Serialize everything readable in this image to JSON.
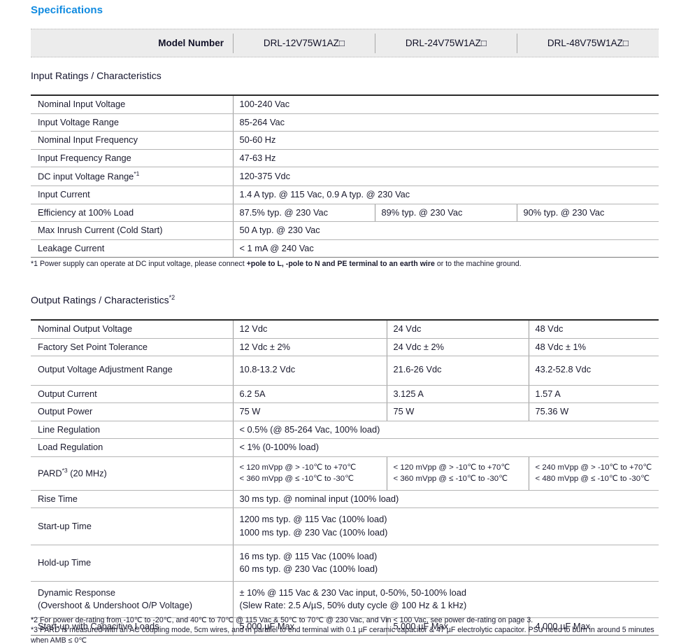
{
  "title": "Specifications",
  "accent_color": "#0f8ae0",
  "header_bg": "#ececec",
  "model_header": {
    "label": "Model Number",
    "models": [
      "DRL-12V75W1AZ□",
      "DRL-24V75W1AZ□",
      "DRL-48V75W1AZ□"
    ]
  },
  "input_section": {
    "heading": "Input Ratings / Characteristics",
    "rows": [
      {
        "label": "Nominal Input Voltage",
        "span": 3,
        "values": [
          "100-240 Vac"
        ]
      },
      {
        "label": "Input Voltage Range",
        "span": 3,
        "values": [
          "85-264 Vac"
        ]
      },
      {
        "label": "Nominal Input Frequency",
        "span": 3,
        "values": [
          "50-60 Hz"
        ]
      },
      {
        "label": "Input Frequency Range",
        "span": 3,
        "values": [
          "47-63 Hz"
        ]
      },
      {
        "label": "DC input Voltage Range",
        "sup": "*1",
        "span": 3,
        "values": [
          "120-375 Vdc"
        ]
      },
      {
        "label": "Input Current",
        "span": 3,
        "values": [
          "1.4 A typ. @ 115 Vac, 0.9 A typ. @ 230 Vac"
        ]
      },
      {
        "label": "Efficiency at 100% Load",
        "span": 1,
        "values": [
          "87.5% typ. @ 230 Vac",
          "89% typ. @ 230 Vac",
          "90% typ. @ 230 Vac"
        ]
      },
      {
        "label": "Max Inrush Current (Cold Start)",
        "span": 3,
        "values": [
          "50 A typ. @ 230 Vac"
        ]
      },
      {
        "label": "Leakage Current",
        "span": 3,
        "values": [
          "< 1 mA @ 240 Vac"
        ]
      }
    ],
    "footnote_prefix": "*1 Power supply can operate at DC input voltage, please connect ",
    "footnote_bold": "+pole to L, -pole to N and PE terminal to an earth wire",
    "footnote_suffix": " or to the machine ground."
  },
  "output_section": {
    "heading": "Output Ratings / Characteristics",
    "heading_sup": "*2",
    "rows": [
      {
        "label": "Nominal Output Voltage",
        "span": 1,
        "values": [
          "12 Vdc",
          "24 Vdc",
          "48 Vdc"
        ]
      },
      {
        "label": "Factory Set Point Tolerance",
        "span": 1,
        "values": [
          "12 Vdc ± 2%",
          "24 Vdc ± 2%",
          "48 Vdc ± 1%"
        ]
      },
      {
        "label": "Output Voltage Adjustment Range",
        "span": 1,
        "values": [
          "10.8-13.2 Vdc",
          "21.6-26 Vdc",
          "43.2-52.8 Vdc"
        ]
      },
      {
        "label": "Output Current",
        "span": 1,
        "values": [
          "6.2 5A",
          "3.125 A",
          "1.57 A"
        ]
      },
      {
        "label": "Output Power",
        "span": 1,
        "values": [
          "75 W",
          "75 W",
          "75.36 W"
        ]
      },
      {
        "label": "Line Regulation",
        "span": 3,
        "values": [
          "< 0.5% (@ 85-264 Vac, 100% load)"
        ]
      },
      {
        "label": "Load Regulation",
        "span": 3,
        "values": [
          "< 1% (0-100% load)"
        ]
      },
      {
        "label": "PARD",
        "sup": "*3",
        "label_tail": " (20 MHz)",
        "span": 1,
        "variant": "pard",
        "multi": [
          [
            "< 120 mVpp @ > -10℃ to +70℃",
            "< 360 mVpp @ ≤ -10℃ to -30℃"
          ],
          [
            "< 120 mVpp @ > -10℃ to +70℃",
            "< 360 mVpp @ ≤ -10℃ to -30℃"
          ],
          [
            "< 240 mVpp @ > -10℃ to +70℃",
            "< 480 mVpp @ ≤ -10℃ to -30℃"
          ]
        ]
      },
      {
        "label": "Rise Time",
        "span": 3,
        "values": [
          "30 ms typ. @ nominal input (100% load)"
        ]
      },
      {
        "label": "Start-up Time",
        "span": 3,
        "lines": [
          "1200 ms typ. @ 115 Vac (100% load)",
          "1000 ms typ. @ 230 Vac (100% load)"
        ]
      },
      {
        "label": "Hold-up Time",
        "span": 3,
        "lines": [
          "16 ms typ. @ 115 Vac (100% load)",
          "60 ms typ. @ 230 Vac (100% load)"
        ]
      },
      {
        "label_lines": [
          "Dynamic Response",
          "(Overshoot & Undershoot O/P Voltage)"
        ],
        "span": 3,
        "lines": [
          "± 10% @ 115 Vac & 230 Vac input, 0-50%, 50-100% load",
          "(Slew Rate: 2.5 A/µS, 50% duty cycle @ 100 Hz & 1 kHz)"
        ]
      },
      {
        "label": "Start-up with Capacitive Loads",
        "span": 1,
        "variant": "cap",
        "values": [
          "5,000 µF Max",
          "5,000 µF Max",
          "4,000 µF Max"
        ]
      }
    ],
    "footnote2": "*2 For power de-rating from -10℃ to -20℃, and 40℃ to 70℃ @ 115 Vac & 50℃ to 70℃ @ 230 Vac, and Vin < 100 Vac, see power de-rating on page 3.",
    "footnote3": "*3 PARD is measured with an AC coupling mode, 5cm wires, and in parallel to end terminal with 0.1 µF ceramic capacitor & 47 µF electrolytic capacitor. PSU need to burn in around 5 minutes when AMB ≤ 0℃"
  }
}
